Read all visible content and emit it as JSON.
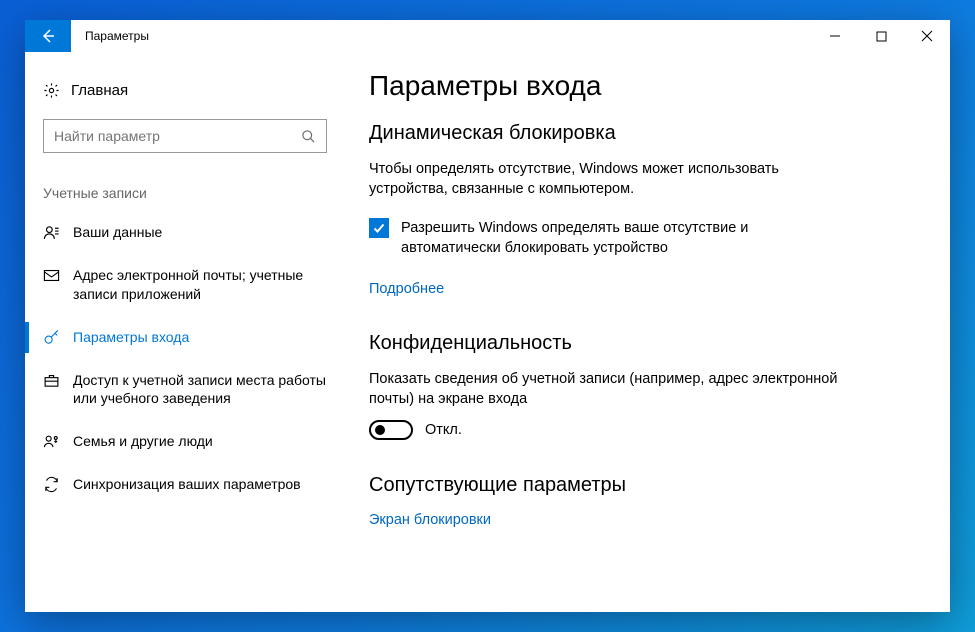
{
  "window": {
    "title": "Параметры"
  },
  "sidebar": {
    "home": "Главная",
    "searchPlaceholder": "Найти параметр",
    "category": "Учетные записи",
    "items": [
      {
        "label": "Ваши данные",
        "icon": "person"
      },
      {
        "label": "Адрес электронной почты; учетные записи приложений",
        "icon": "mail"
      },
      {
        "label": "Параметры входа",
        "icon": "key",
        "selected": true
      },
      {
        "label": "Доступ к учетной записи места работы или учебного заведения",
        "icon": "briefcase"
      },
      {
        "label": "Семья и другие люди",
        "icon": "family"
      },
      {
        "label": "Синхронизация ваших параметров",
        "icon": "sync"
      }
    ]
  },
  "main": {
    "pageTitle": "Параметры входа",
    "dynamicLock": {
      "heading": "Динамическая блокировка",
      "body": "Чтобы определять отсутствие, Windows может использовать устройства, связанные с компьютером.",
      "checkboxLabel": "Разрешить Windows определять ваше отсутствие и автоматически блокировать устройство",
      "checked": true,
      "moreLink": "Подробнее"
    },
    "privacy": {
      "heading": "Конфиденциальность",
      "body": "Показать сведения об учетной записи (например, адрес электронной почты) на экране входа",
      "toggleState": "Откл."
    },
    "related": {
      "heading": "Сопутствующие параметры",
      "link": "Экран блокировки"
    }
  }
}
